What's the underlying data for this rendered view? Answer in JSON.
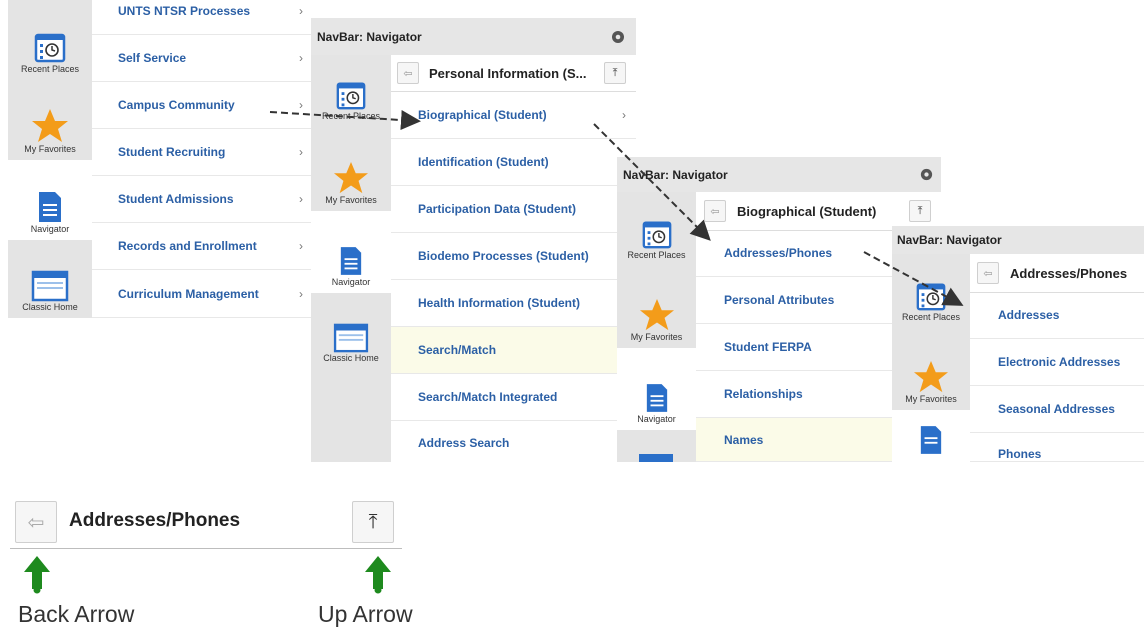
{
  "panel1": {
    "sidebar": [
      {
        "label": "Recent Places",
        "icon": "calendar-clock-icon"
      },
      {
        "label": "My Favorites",
        "icon": "star-icon"
      },
      {
        "label": "Navigator",
        "icon": "document-icon"
      },
      {
        "label": "Classic Home",
        "icon": "window-icon"
      }
    ],
    "items": [
      "UNTS NTSR Processes",
      "Self Service",
      "Campus Community",
      "Student Recruiting",
      "Student Admissions",
      "Records and Enrollment",
      "Curriculum Management"
    ]
  },
  "panel2": {
    "title": "NavBar: Navigator",
    "subtitle": "Personal Information (S...",
    "sidebar": [
      {
        "label": "Recent Places",
        "icon": "calendar-clock-icon"
      },
      {
        "label": "My Favorites",
        "icon": "star-icon"
      },
      {
        "label": "Navigator",
        "icon": "document-icon"
      },
      {
        "label": "Classic Home",
        "icon": "window-icon"
      }
    ],
    "items": [
      "Biographical (Student)",
      "Identification (Student)",
      "Participation Data (Student)",
      "Biodemo Processes (Student)",
      "Health Information (Student)",
      "Search/Match",
      "Search/Match Integrated",
      "Address Search"
    ]
  },
  "panel3": {
    "title": "NavBar: Navigator",
    "subtitle": "Biographical (Student)",
    "sidebar": [
      {
        "label": "Recent Places",
        "icon": "calendar-clock-icon"
      },
      {
        "label": "My Favorites",
        "icon": "star-icon"
      },
      {
        "label": "Navigator",
        "icon": "document-icon"
      }
    ],
    "items": [
      "Addresses/Phones",
      "Personal Attributes",
      "Student FERPA",
      "Relationships",
      "Names"
    ]
  },
  "panel4": {
    "title": "NavBar: Navigator",
    "subtitle": "Addresses/Phones",
    "sidebar": [
      {
        "label": "Recent Places",
        "icon": "calendar-clock-icon"
      },
      {
        "label": "My Favorites",
        "icon": "star-icon"
      }
    ],
    "items": [
      "Addresses",
      "Electronic Addresses",
      "Seasonal Addresses",
      "Phones"
    ]
  },
  "bottom": {
    "title": "Addresses/Phones",
    "back_caption": "Back Arrow",
    "up_caption": "Up Arrow"
  },
  "colors": {
    "link": "#2b5fa5",
    "star": "#f39c1a",
    "icon_blue": "#2a6fc9",
    "caption_arrow": "#1e8a1e"
  }
}
